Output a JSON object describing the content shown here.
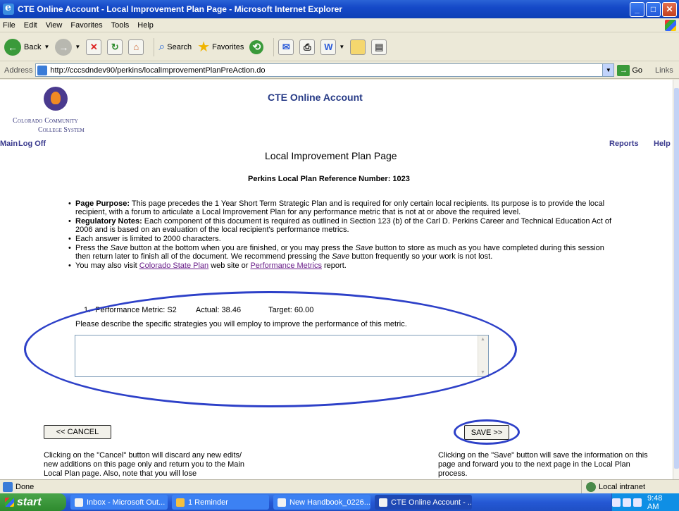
{
  "window": {
    "title": "CTE Online Account - Local Improvement Plan Page - Microsoft Internet Explorer",
    "buttons": {
      "minimize": "_",
      "maximize": "□",
      "close": "✕"
    }
  },
  "menu": [
    "File",
    "Edit",
    "View",
    "Favorites",
    "Tools",
    "Help"
  ],
  "toolbar": {
    "back": "Back",
    "search": "Search",
    "favorites": "Favorites"
  },
  "address": {
    "label": "Address",
    "url": "http://cccsdndev90/perkins/localImprovementPlanPreAction.do",
    "go": "Go",
    "links": "Links"
  },
  "page": {
    "logo_line1": "Colorado Community",
    "logo_line2": "College System",
    "app_title": "CTE Online Account",
    "nav": {
      "main": "Main",
      "logoff": "Log Off",
      "reports": "Reports",
      "help": "Help"
    },
    "title": "Local Improvement Plan Page",
    "reference": "Perkins Local Plan Reference Number: 1023",
    "bullets": {
      "purpose_label": "Page Purpose:",
      "purpose_text": " This page precedes the 1 Year Short Term Strategic Plan and is required for only certain local recipients. Its purpose is to provide the local recipient, with a forum to articulate a Local Improvement Plan for any performance metric that is not at or above the required level.",
      "regulatory_label": "Regulatory Notes:",
      "regulatory_text": " Each component of this document is required as outlined in Section 123 (b) of the Carl D. Perkins Career and Technical Education Act of 2006 and is based on an evaluation of the local recipient's performance metrics.",
      "limit_text": "Each answer is limited to 2000 characters.",
      "save_pre": "Press the ",
      "save_word1": "Save",
      "save_mid": " button at the bottom when you are finished, or you may press the ",
      "save_word2": "Save",
      "save_mid2": " button to store as much as you have completed during this session then return later to finish all of the document. We recommend pressing the ",
      "save_word3": "Save",
      "save_post": " button frequently so your work is not lost.",
      "visit_pre": "You may also visit ",
      "visit_link1": "Colorado State Plan",
      "visit_mid": " web site or ",
      "visit_link2": "Performance Metrics",
      "visit_post": " report."
    },
    "metric": {
      "number": "1.",
      "label": "Performance Metric: S2",
      "actual": "Actual: 38.46",
      "target": "Target: 60.00",
      "prompt": "Please describe the specific strategies you will employ to improve the performance of this metric.",
      "answer": ""
    },
    "cancel_label": "<< CANCEL",
    "save_label": "SAVE >>",
    "cancel_note": "Clicking on the \"Cancel\" button will discard any new edits/ new additions on this page only and return you to the Main Local Plan page. Also, note that you will lose",
    "save_note": "Clicking on the \"Save\" button will save the information on this page and forward you to the next page in the Local Plan process."
  },
  "status": {
    "text": "Done",
    "zone": "Local intranet"
  },
  "taskbar": {
    "start": "start",
    "tasks": [
      "Inbox - Microsoft Out...",
      "1 Reminder",
      "New Handbook_0226...",
      "CTE Online Account - ..."
    ],
    "clock": "9:48 AM"
  }
}
